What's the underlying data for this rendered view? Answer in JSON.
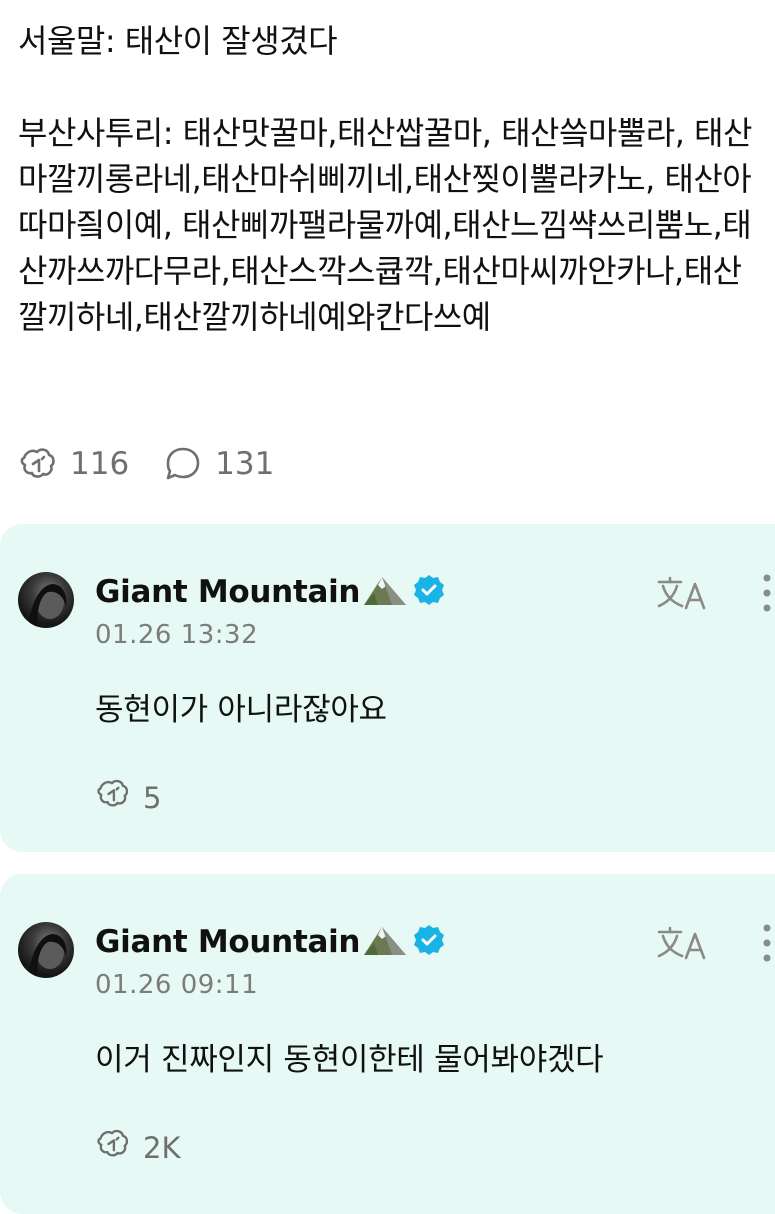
{
  "post": {
    "line_seoul": "서울말: 태산이 잘생겼다",
    "line_busan": "부산사투리: 태산맛꿀마,태산쌉꿀마, 태산씈마뿔라, 태산마깔끼롱라네,태산마쉬삐끼네,태산찢이뿔라카노, 태산아따마즼이예, 태산삐까팰라물까예,태산느낌쌱쓰리뿜노,태산까쓰까다무라,태산스깍스큡깍,태산마씨까안카나,태산깔끼하네,태산깔끼하네예와칸다쓰예",
    "repost_icon": "repost-icon",
    "repost_count": "116",
    "comment_icon": "comment-bubble-icon",
    "comment_count": "131"
  },
  "replies": [
    {
      "author": "Giant Mountain",
      "author_emoji": "mountain-emoji",
      "verified_icon": "verified-badge-icon",
      "timestamp": "01.26 13:32",
      "text": "동현이가 아니라잖아요",
      "repost_count": "5",
      "translate_icon": "translate-icon",
      "more_icon": "more-vertical-icon"
    },
    {
      "author": "Giant Mountain",
      "author_emoji": "mountain-emoji",
      "verified_icon": "verified-badge-icon",
      "timestamp": "01.26 09:11",
      "text": "이거 진짜인지 동현이한테 물어봐야겠다",
      "repost_count": "2K",
      "translate_icon": "translate-icon",
      "more_icon": "more-vertical-icon"
    }
  ],
  "colors": {
    "reply_background": "#e6f9f4",
    "verified": "#1ab3e5",
    "meta_text": "#7c7c7c"
  }
}
